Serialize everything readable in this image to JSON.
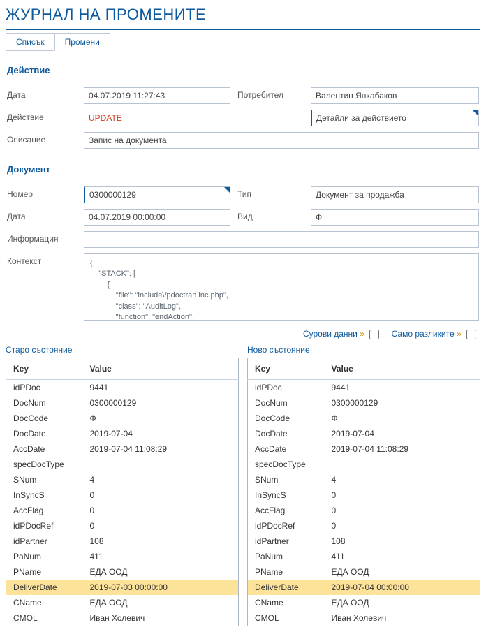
{
  "page": {
    "title": "ЖУРНАЛ НА ПРОМЕНИТЕ"
  },
  "tabs": {
    "list": "Списък",
    "changes": "Промени"
  },
  "section_action": {
    "title": "Действие",
    "date_label": "Дата",
    "date_value": "04.07.2019 11:27:43",
    "user_label": "Потребител",
    "user_value": "Валентин Янкабаков",
    "action_label": "Действие",
    "action_value": "UPDATE",
    "details_button": "Детайли за действието",
    "desc_label": "Описание",
    "desc_value": "Запис на документа"
  },
  "section_doc": {
    "title": "Документ",
    "num_label": "Номер",
    "num_value": "0300000129",
    "type_label": "Тип",
    "type_value": "Документ за продажба",
    "date_label": "Дата",
    "date_value": "04.07.2019 00:00:00",
    "kind_label": "Вид",
    "kind_value": "Ф",
    "info_label": "Информация",
    "context_label": "Контекст",
    "context_value": "{\n    \"STACK\": [\n        {\n            \"file\": \"include\\/pdoctran.inc.php\",\n            \"class\": \"AuditLog\",\n            \"function\": \"endAction\","
  },
  "toggles": {
    "raw": "Сурови данни",
    "diff_only": "Само разликите"
  },
  "states": {
    "old_title": "Старо състояние",
    "new_title": "Ново състояние",
    "key_header": "Key",
    "value_header": "Value",
    "rows": [
      {
        "k": "idPDoc",
        "old": "9441",
        "new": "9441",
        "hl": false
      },
      {
        "k": "DocNum",
        "old": "0300000129",
        "new": "0300000129",
        "hl": false
      },
      {
        "k": "DocCode",
        "old": "Ф",
        "new": "Ф",
        "hl": false
      },
      {
        "k": "DocDate",
        "old": "2019-07-04",
        "new": "2019-07-04",
        "hl": false
      },
      {
        "k": "AccDate",
        "old": "2019-07-04 11:08:29",
        "new": "2019-07-04 11:08:29",
        "hl": false
      },
      {
        "k": "specDocType",
        "old": "",
        "new": "",
        "hl": false
      },
      {
        "k": "SNum",
        "old": "4",
        "new": "4",
        "hl": false
      },
      {
        "k": "InSyncS",
        "old": "0",
        "new": "0",
        "hl": false
      },
      {
        "k": "AccFlag",
        "old": "0",
        "new": "0",
        "hl": false
      },
      {
        "k": "idPDocRef",
        "old": "0",
        "new": "0",
        "hl": false
      },
      {
        "k": "idPartner",
        "old": "108",
        "new": "108",
        "hl": false
      },
      {
        "k": "PaNum",
        "old": "411",
        "new": "411",
        "hl": false
      },
      {
        "k": "PName",
        "old": "ЕДА ООД",
        "new": "ЕДА ООД",
        "hl": false
      },
      {
        "k": "DeliverDate",
        "old": "2019-07-03 00:00:00",
        "new": "2019-07-04 00:00:00",
        "hl": true
      },
      {
        "k": "CName",
        "old": "ЕДА ООД",
        "new": "ЕДА ООД",
        "hl": false
      },
      {
        "k": "CMOL",
        "old": "Иван Холевич",
        "new": "Иван Холевич",
        "hl": false
      }
    ]
  }
}
